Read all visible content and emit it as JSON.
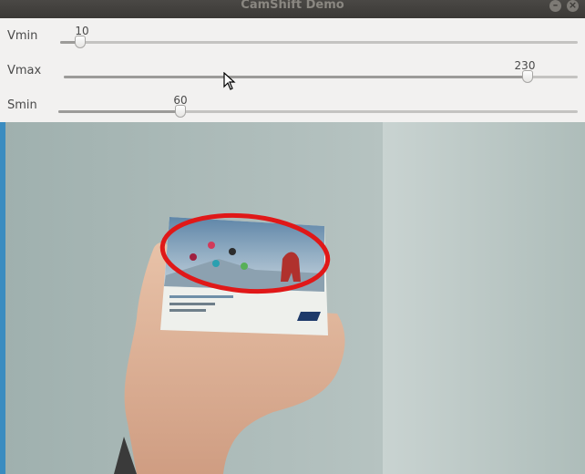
{
  "window": {
    "title": "CamShift Demo",
    "minimize_glyph": "–",
    "close_glyph": "×"
  },
  "sliders": [
    {
      "label": "Vmin",
      "value": "10",
      "level_fraction": 0.039
    },
    {
      "label": "Vmax",
      "value": "230",
      "level_fraction": 0.902
    },
    {
      "label": "Smin",
      "value": "60",
      "level_fraction": 0.235
    }
  ],
  "camera": {
    "tracking_ellipse_color": "#e01818"
  },
  "colors": {
    "panel": "#f2f1f0",
    "titlebar": "#3b3936"
  },
  "icons": {
    "cursor": "arrow-cursor-icon"
  }
}
